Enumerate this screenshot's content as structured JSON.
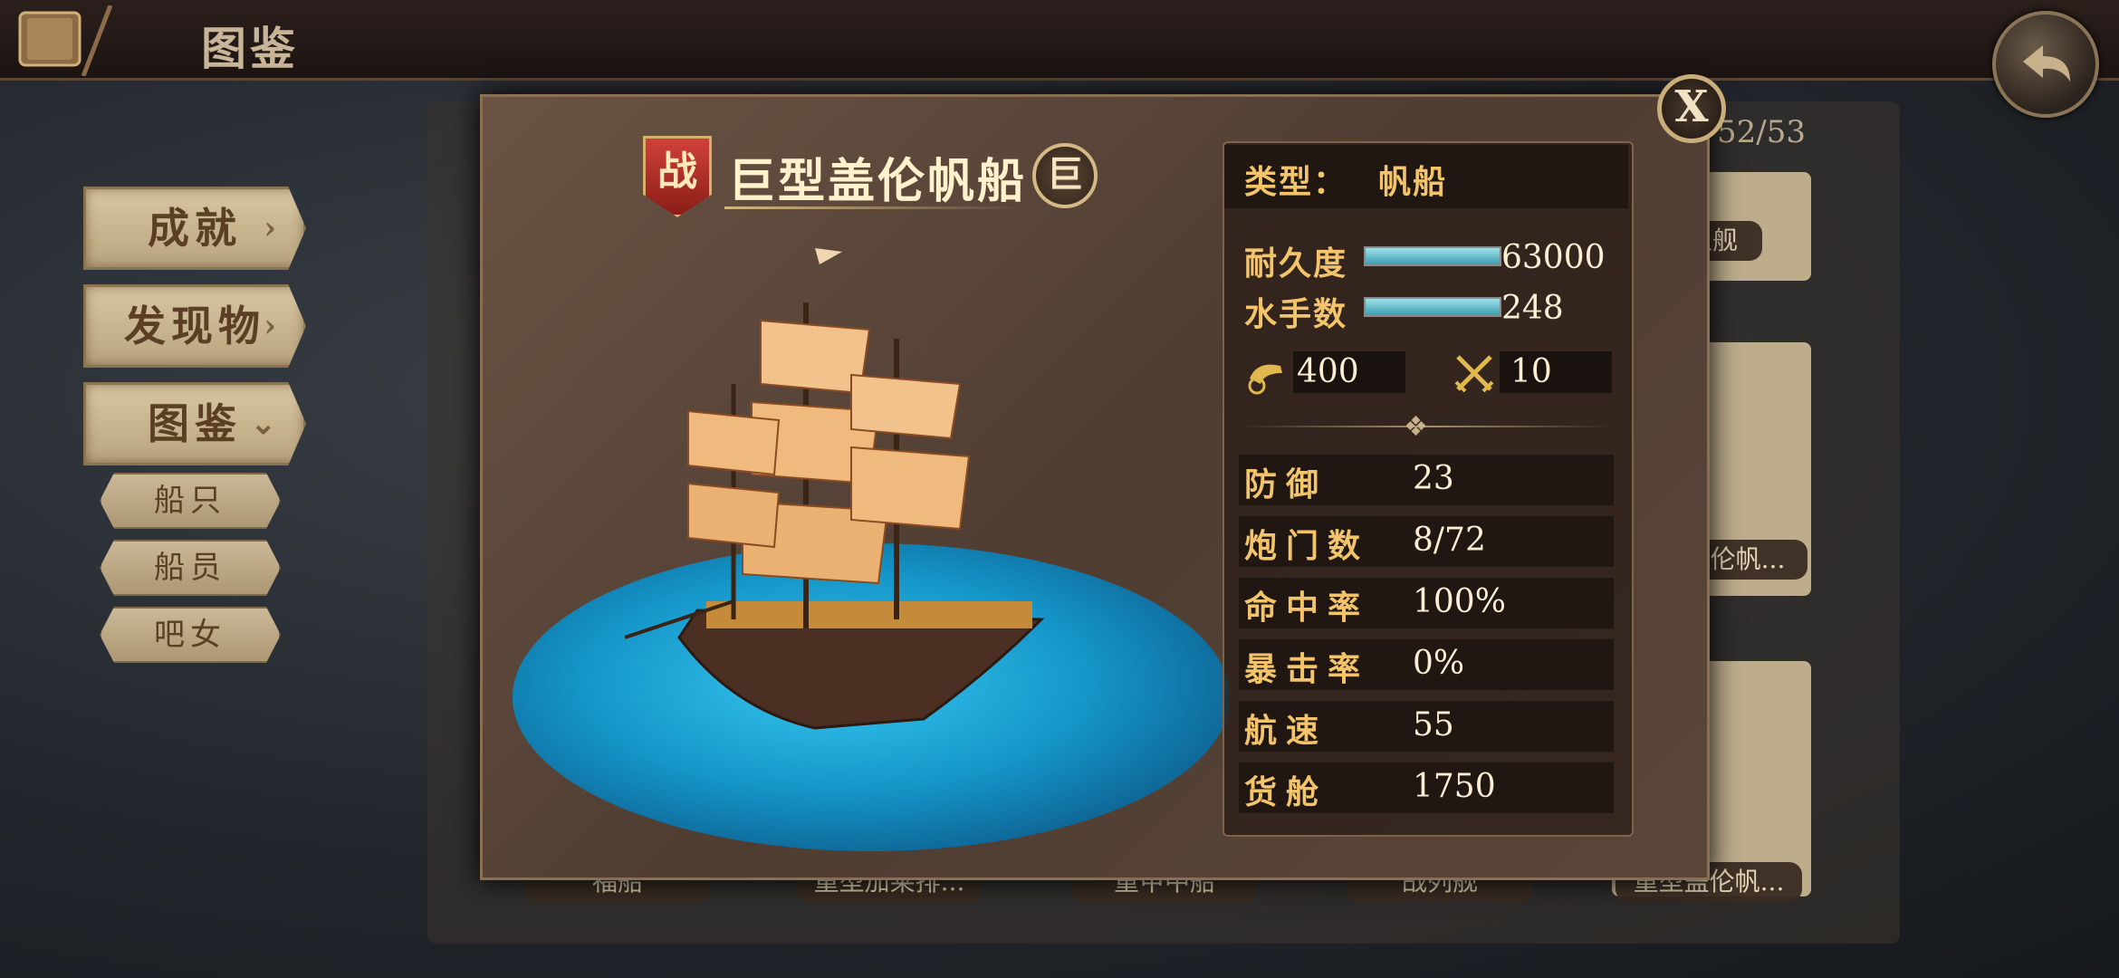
{
  "topbar": {
    "title": "图鉴"
  },
  "menu": {
    "achievements": "成就",
    "discoveries": "发现物",
    "codex": "图鉴",
    "sub": [
      "船只",
      "船员",
      "吧女"
    ]
  },
  "grid": {
    "count": "52/53",
    "labels_top": [
      "卫舰"
    ],
    "labels_mid": [
      "盖伦帆..."
    ],
    "labels_bottom": [
      "福船",
      "重型加莱排...",
      "重甲中船",
      "战列舰",
      "重型盖伦帆..."
    ]
  },
  "modal": {
    "close": "X",
    "war_badge": "战",
    "ship_name": "巨型盖伦帆船",
    "size_badge": "巨",
    "type_label": "类型：",
    "type_value": "帆船",
    "durability_label": "耐久度",
    "durability_value": "63000",
    "durability_fill": 1.0,
    "crew_label": "水手数",
    "crew_value": "248",
    "crew_fill": 1.0,
    "cannon_value": "400",
    "melee_value": "10",
    "stats": [
      {
        "k": "防御",
        "v": "23"
      },
      {
        "k": "炮门数",
        "v": "8/72"
      },
      {
        "k": "命中率",
        "v": "100%"
      },
      {
        "k": "暴击率",
        "v": "0%"
      },
      {
        "k": "航速",
        "v": "55"
      },
      {
        "k": "货舱",
        "v": "1750"
      }
    ]
  },
  "colors": {
    "accent": "#f3c46a",
    "value": "#fbeed3",
    "bar": "#3c9fb2"
  }
}
